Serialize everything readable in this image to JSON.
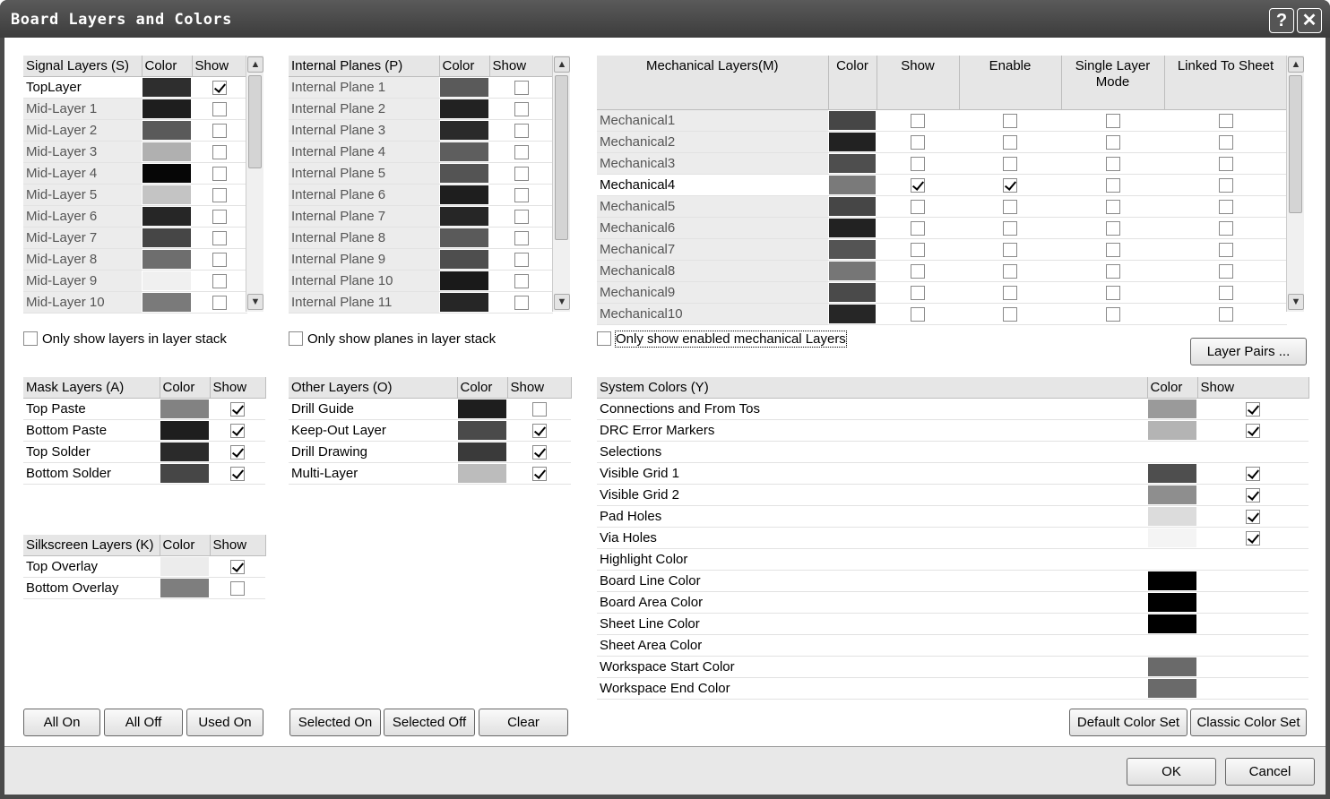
{
  "window": {
    "title": "Board Layers and Colors",
    "help_label": "?",
    "close_label": "✕"
  },
  "signal": {
    "headers": [
      "Signal Layers (S)",
      "Color",
      "Show"
    ],
    "rows": [
      {
        "name": "TopLayer",
        "color": "#2e2e2e",
        "show": true,
        "selected": true
      },
      {
        "name": "Mid-Layer 1",
        "color": "#1e1e1e",
        "show": false
      },
      {
        "name": "Mid-Layer 2",
        "color": "#5a5a5a",
        "show": false
      },
      {
        "name": "Mid-Layer 3",
        "color": "#b0b0b0",
        "show": false
      },
      {
        "name": "Mid-Layer 4",
        "color": "#060606",
        "show": false
      },
      {
        "name": "Mid-Layer 5",
        "color": "#c4c4c4",
        "show": false
      },
      {
        "name": "Mid-Layer 6",
        "color": "#262626",
        "show": false
      },
      {
        "name": "Mid-Layer 7",
        "color": "#464646",
        "show": false
      },
      {
        "name": "Mid-Layer 8",
        "color": "#6e6e6e",
        "show": false
      },
      {
        "name": "Mid-Layer 9",
        "color": "#f0f0f0",
        "show": false
      },
      {
        "name": "Mid-Layer 10",
        "color": "#7a7a7a",
        "show": false
      }
    ]
  },
  "planes": {
    "headers": [
      "Internal Planes (P)",
      "Color",
      "Show"
    ],
    "rows": [
      {
        "name": "Internal Plane 1",
        "color": "#5a5a5a",
        "show": false
      },
      {
        "name": "Internal Plane 2",
        "color": "#222222",
        "show": false
      },
      {
        "name": "Internal Plane 3",
        "color": "#2a2a2a",
        "show": false
      },
      {
        "name": "Internal Plane 4",
        "color": "#5e5e5e",
        "show": false
      },
      {
        "name": "Internal Plane 5",
        "color": "#545454",
        "show": false
      },
      {
        "name": "Internal Plane 6",
        "color": "#1e1e1e",
        "show": false
      },
      {
        "name": "Internal Plane 7",
        "color": "#262626",
        "show": false
      },
      {
        "name": "Internal Plane 8",
        "color": "#5a5a5a",
        "show": false
      },
      {
        "name": "Internal Plane 9",
        "color": "#4e4e4e",
        "show": false
      },
      {
        "name": "Internal Plane 10",
        "color": "#1a1a1a",
        "show": false
      },
      {
        "name": "Internal Plane 11",
        "color": "#262626",
        "show": false
      }
    ]
  },
  "mech": {
    "headers": [
      "Mechanical Layers(M)",
      "Color",
      "Show",
      "Enable",
      "Single Layer Mode",
      "Linked To Sheet"
    ],
    "rows": [
      {
        "name": "Mechanical1",
        "color": "#464646",
        "show": false,
        "enable": false
      },
      {
        "name": "Mechanical2",
        "color": "#222222",
        "show": false,
        "enable": false
      },
      {
        "name": "Mechanical3",
        "color": "#4e4e4e",
        "show": false,
        "enable": false
      },
      {
        "name": "Mechanical4",
        "color": "#7a7a7a",
        "show": true,
        "enable": true,
        "selected": true
      },
      {
        "name": "Mechanical5",
        "color": "#464646",
        "show": false,
        "enable": false
      },
      {
        "name": "Mechanical6",
        "color": "#222222",
        "show": false,
        "enable": false
      },
      {
        "name": "Mechanical7",
        "color": "#545454",
        "show": false,
        "enable": false
      },
      {
        "name": "Mechanical8",
        "color": "#767676",
        "show": false,
        "enable": false
      },
      {
        "name": "Mechanical9",
        "color": "#4a4a4a",
        "show": false,
        "enable": false
      },
      {
        "name": "Mechanical10",
        "color": "#262626",
        "show": false,
        "enable": false
      }
    ]
  },
  "options": {
    "only_layers": "Only show layers in layer stack",
    "only_planes": "Only show planes in layer stack",
    "only_mech": "Only show enabled mechanical Layers",
    "layer_pairs": "Layer Pairs ..."
  },
  "mask": {
    "headers": [
      "Mask Layers (A)",
      "Color",
      "Show"
    ],
    "rows": [
      {
        "name": "Top Paste",
        "color": "#828282",
        "show": true
      },
      {
        "name": "Bottom Paste",
        "color": "#1e1e1e",
        "show": true
      },
      {
        "name": "Top Solder",
        "color": "#2a2a2a",
        "show": true
      },
      {
        "name": "Bottom Solder",
        "color": "#464646",
        "show": true
      }
    ]
  },
  "other": {
    "headers": [
      "Other Layers (O)",
      "Color",
      "Show"
    ],
    "rows": [
      {
        "name": "Drill Guide",
        "color": "#1e1e1e",
        "show": false
      },
      {
        "name": "Keep-Out Layer",
        "color": "#4a4a4a",
        "show": true
      },
      {
        "name": "Drill Drawing",
        "color": "#3a3a3a",
        "show": true
      },
      {
        "name": "Multi-Layer",
        "color": "#bcbcbc",
        "show": true
      }
    ]
  },
  "silk": {
    "headers": [
      "Silkscreen Layers (K)",
      "Color",
      "Show"
    ],
    "rows": [
      {
        "name": "Top Overlay",
        "color": "#ececec",
        "show": true
      },
      {
        "name": "Bottom Overlay",
        "color": "#7e7e7e",
        "show": false
      }
    ]
  },
  "system": {
    "headers": [
      "System Colors (Y)",
      "Color",
      "Show"
    ],
    "rows": [
      {
        "name": "Connections and From Tos",
        "color": "#9a9a9a",
        "show": true,
        "has_show": true
      },
      {
        "name": "DRC Error Markers",
        "color": "#b4b4b4",
        "show": true,
        "has_show": true
      },
      {
        "name": "Selections",
        "color": "#ffffff",
        "show": false,
        "has_show": false
      },
      {
        "name": "Visible Grid 1",
        "color": "#4e4e4e",
        "show": true,
        "has_show": true
      },
      {
        "name": "Visible Grid 2",
        "color": "#8e8e8e",
        "show": true,
        "has_show": true
      },
      {
        "name": "Pad Holes",
        "color": "#dcdcdc",
        "show": true,
        "has_show": true
      },
      {
        "name": "Via Holes",
        "color": "#f4f4f4",
        "show": true,
        "has_show": true
      },
      {
        "name": "Highlight Color",
        "color": "#ffffff",
        "show": false,
        "has_show": false
      },
      {
        "name": "Board Line Color",
        "color": "#000000",
        "show": false,
        "has_show": false
      },
      {
        "name": "Board Area Color",
        "color": "#000000",
        "show": false,
        "has_show": false
      },
      {
        "name": "Sheet Line Color",
        "color": "#000000",
        "show": false,
        "has_show": false
      },
      {
        "name": "Sheet Area Color",
        "color": "#ffffff",
        "show": false,
        "has_show": false
      },
      {
        "name": "Workspace Start Color",
        "color": "#6a6a6a",
        "show": false,
        "has_show": false
      },
      {
        "name": "Workspace End Color",
        "color": "#6a6a6a",
        "show": false,
        "has_show": false
      }
    ]
  },
  "buttons": {
    "all_on": "All On",
    "all_off": "All Off",
    "used_on": "Used On",
    "selected_on": "Selected On",
    "selected_off": "Selected Off",
    "clear": "Clear",
    "default_color_set": "Default Color Set",
    "classic_color_set": "Classic Color Set",
    "ok": "OK",
    "cancel": "Cancel"
  }
}
